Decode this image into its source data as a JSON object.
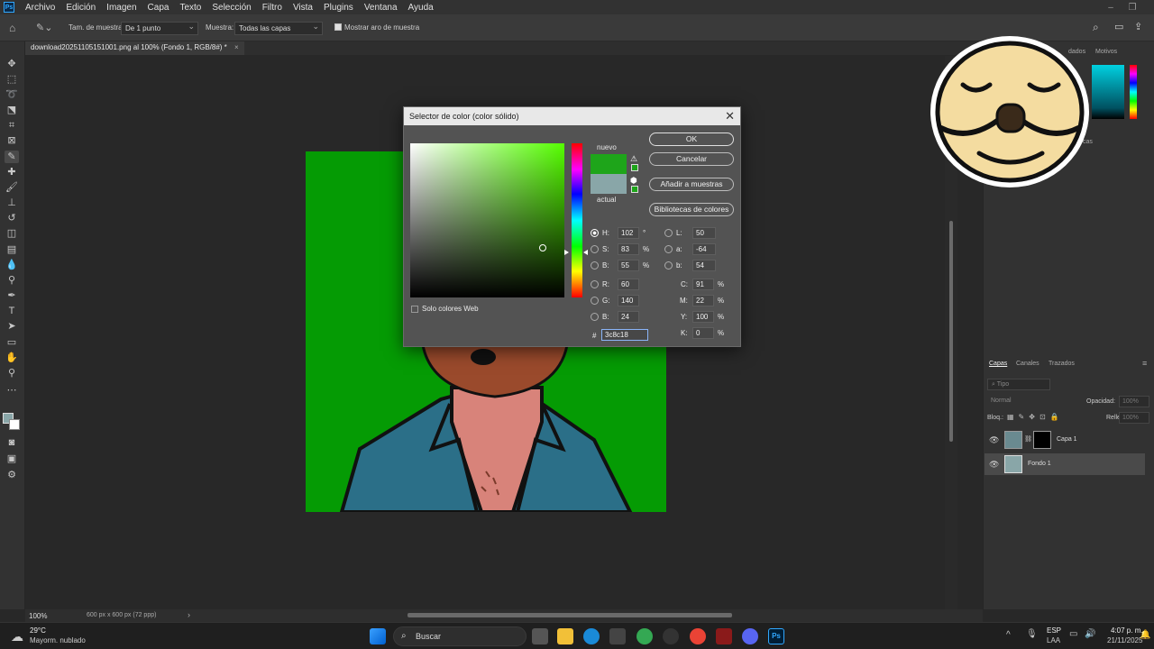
{
  "menubar": {
    "items": [
      "Archivo",
      "Edición",
      "Imagen",
      "Capa",
      "Texto",
      "Selección",
      "Filtro",
      "Vista",
      "Plugins",
      "Ventana",
      "Ayuda"
    ]
  },
  "options": {
    "sample_size_label": "Tam. de muestra:",
    "sample_size_value": "De 1 punto",
    "sample_label": "Muestra:",
    "sample_value": "Todas las capas",
    "show_ring_label": "Mostrar aro de muestra"
  },
  "document": {
    "tab_title": "download20251105151001.png al 100% (Fondo 1, RGB/8#) *",
    "zoom": "100%",
    "doc_info": "600 px x 600 px (72 ppp)"
  },
  "dialog": {
    "title": "Selector de color (color sólido)",
    "new_label": "nuevo",
    "current_label": "actual",
    "new_color": "#1ea51a",
    "current_color": "#89a6a8",
    "buttons": {
      "ok": "OK",
      "cancel": "Cancelar",
      "add_swatch": "Añadir a muestras",
      "libraries": "Bibliotecas de colores"
    },
    "web_only_label": "Solo colores Web",
    "hsb": {
      "h_label": "H:",
      "h": "102",
      "h_unit": "°",
      "s_label": "S:",
      "s": "83",
      "s_unit": "%",
      "b_label": "B:",
      "b": "55",
      "b_unit": "%"
    },
    "rgb": {
      "r_label": "R:",
      "r": "60",
      "g_label": "G:",
      "g": "140",
      "b_label": "B:",
      "b": "24"
    },
    "lab": {
      "l_label": "L:",
      "l": "50",
      "a_label": "a:",
      "a": "-64",
      "b_label": "b:",
      "b": "54"
    },
    "cmyk": {
      "c_label": "C:",
      "c": "91",
      "m_label": "M:",
      "m": "22",
      "y_label": "Y:",
      "y": "100",
      "k_label": "K:",
      "k": "0",
      "unit": "%"
    },
    "hex_label": "#",
    "hex": "3c8c18"
  },
  "panels": {
    "top_tabs": [
      "Motivos"
    ],
    "top_tab_partial": "dados",
    "mid_tab_partial": "cas",
    "layers_tabs": [
      "Capas",
      "Canales",
      "Trazados"
    ],
    "search_placeholder": "Tipo",
    "blend_mode": "Normal",
    "opacity_label": "Opacidad:",
    "opacity_value": "100%",
    "lock_label": "Bloq.:",
    "fill_label": "Relleno:",
    "fill_value": "100%",
    "layers": [
      {
        "name": "Capa 1"
      },
      {
        "name": "Fondo 1"
      }
    ]
  },
  "taskbar": {
    "weather_temp": "29°C",
    "weather_desc": "Mayorm. nublado",
    "search_label": "Buscar",
    "lang": "ESP",
    "lang_sub": "LAA",
    "time": "4:07 p. m.",
    "date": "21/11/2025"
  },
  "colors": {
    "canvas_green": "#059b04",
    "accent": "#31a8ff"
  }
}
